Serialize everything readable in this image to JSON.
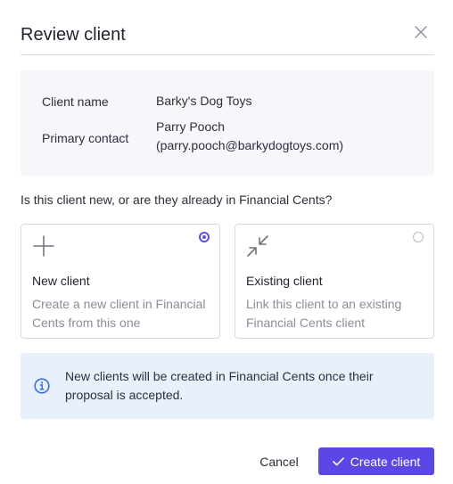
{
  "dialog": {
    "title": "Review client",
    "close_icon": "close-icon"
  },
  "summary": {
    "client_name_label": "Client name",
    "client_name_value": "Barky's Dog Toys",
    "primary_contact_label": "Primary contact",
    "primary_contact_name": "Parry Pooch",
    "primary_contact_email": "(parry.pooch@barkydogtoys.com)"
  },
  "question": "Is this client new, or are they already in Financial Cents?",
  "options": [
    {
      "icon": "plus-icon",
      "title": "New client",
      "description": "Create a new client in Financial Cents from this one",
      "selected": true
    },
    {
      "icon": "collapse-arrows-icon",
      "title": "Existing client",
      "description": "Link this client to an existing Financial Cents client",
      "selected": false
    }
  ],
  "info": {
    "icon": "info-icon",
    "text": "New clients will be created in Financial Cents once their proposal is accepted."
  },
  "footer": {
    "cancel_label": "Cancel",
    "create_label": "Create client",
    "create_icon": "check-icon"
  },
  "colors": {
    "accent": "#5a47e4",
    "summary_bg": "#f6f6fb",
    "info_bg": "#e7f0fb",
    "info_icon": "#3a6fd8",
    "muted_text": "#8b8d99"
  }
}
